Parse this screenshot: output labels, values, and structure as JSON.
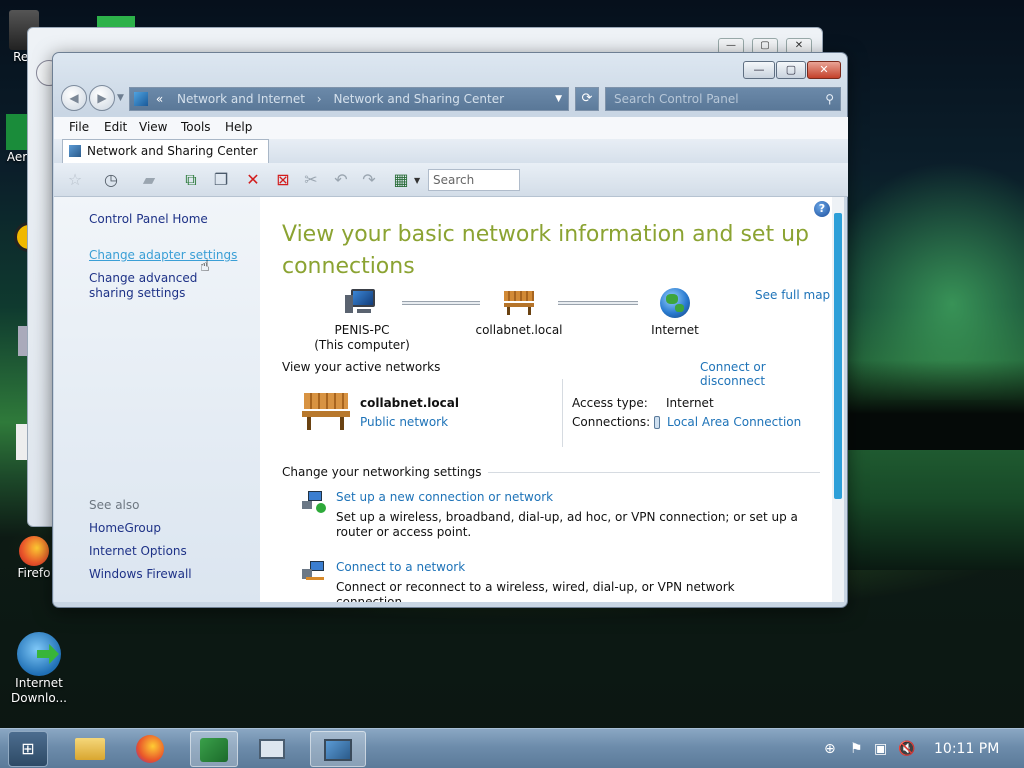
{
  "window": {
    "title": "Network and Sharing Center",
    "address": {
      "prefix": "«",
      "crumb1": "Network and Internet",
      "separator": "›",
      "crumb2": "Network and Sharing Center"
    },
    "search_placeholder": "Search Control Panel",
    "menu": [
      "File",
      "Edit",
      "View",
      "Tools",
      "Help"
    ],
    "tab_label": "Network and Sharing Center",
    "toolbar_search_placeholder": "Search"
  },
  "left_pane": {
    "links": [
      "Control Panel Home",
      "Change adapter settings",
      "Change advanced sharing settings"
    ],
    "see_also_label": "See also",
    "see_also": [
      "HomeGroup",
      "Internet Options",
      "Windows Firewall"
    ]
  },
  "main": {
    "heading": "View your basic network information and set up connections",
    "see_full_map": "See full map",
    "nodes": {
      "computer_name": "PENIS-PC",
      "computer_sub": "(This computer)",
      "network": "collabnet.local",
      "internet": "Internet"
    },
    "active_label": "View your active networks",
    "connect_disconnect": "Connect or disconnect",
    "active_network": {
      "name": "collabnet.local",
      "type": "Public network",
      "access_type_label": "Access type:",
      "access_type_value": "Internet",
      "connections_label": "Connections:",
      "connections_value": "Local Area Connection"
    },
    "settings_label": "Change your networking settings",
    "tasks": [
      {
        "title": "Set up a new connection or network",
        "desc": "Set up a wireless, broadband, dial-up, ad hoc, or VPN connection; or set up a router or access point."
      },
      {
        "title": "Connect to a network",
        "desc": "Connect or reconnect to a wireless, wired, dial-up, or VPN network connection."
      }
    ]
  },
  "desktop_icons": {
    "top_left": "Rec",
    "aero": "Aer",
    "firefox": "Firefo",
    "internet_download": "Internet Downlo..."
  },
  "taskbar": {
    "clock": "10:11 PM"
  }
}
